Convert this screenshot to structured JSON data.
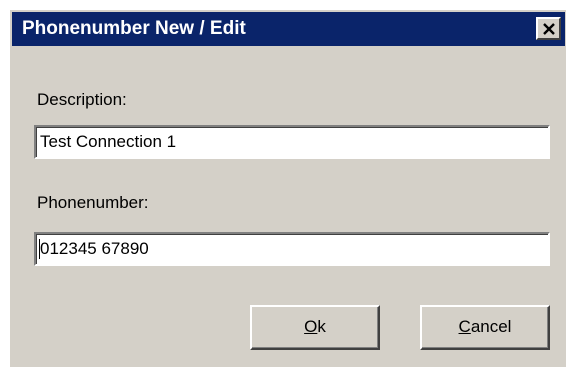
{
  "window": {
    "title": "Phonenumber New / Edit",
    "close_icon": "close-x-icon"
  },
  "form": {
    "description_label": "Description:",
    "description_value": "Test Connection 1",
    "phonenumber_label": "Phonenumber:",
    "phonenumber_value": "012345 67890"
  },
  "buttons": {
    "ok_mnemonic": "O",
    "ok_rest": "k",
    "cancel_mnemonic": "C",
    "cancel_rest": "ancel"
  },
  "colors": {
    "titlebar": "#0a246a",
    "face": "#d4d0c8"
  }
}
